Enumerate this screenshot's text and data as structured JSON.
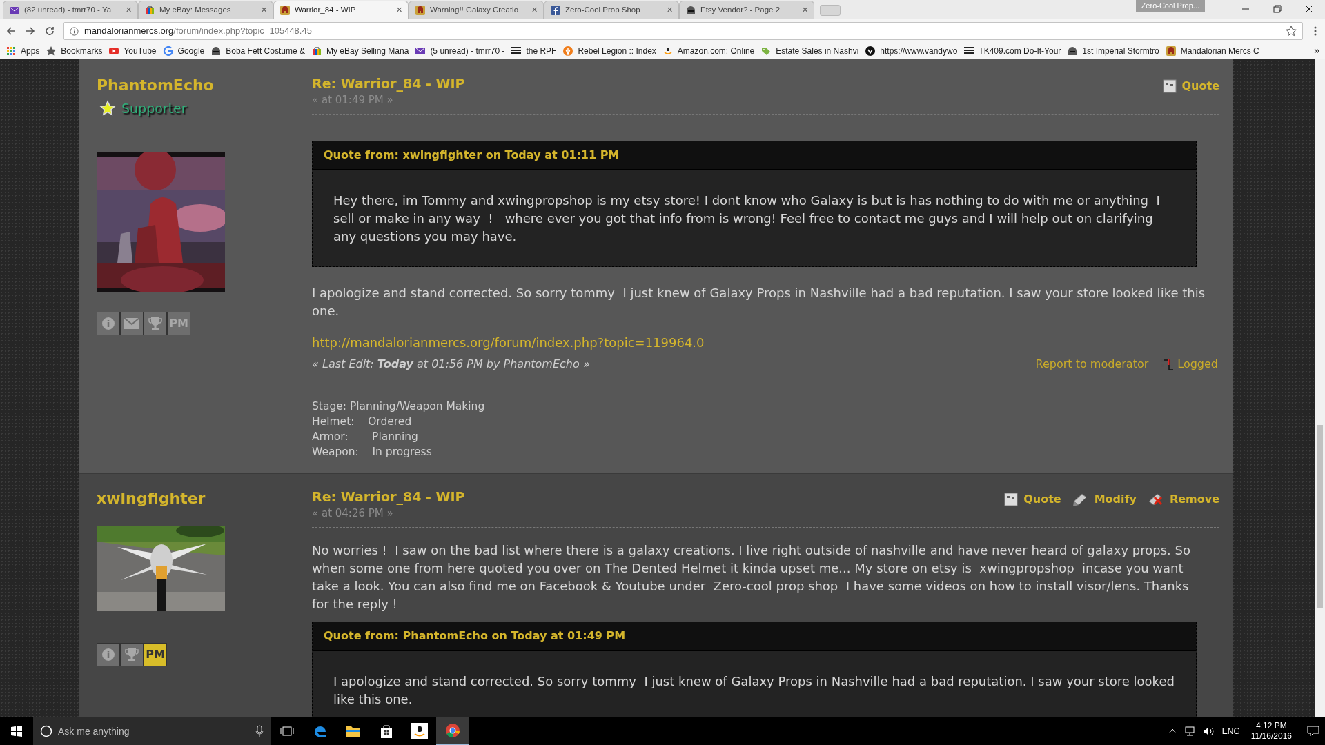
{
  "browser": {
    "tabs": [
      {
        "title": "(82 unread) - tmrr70 - Ya",
        "kind": "mail",
        "selected": false,
        "close": "✕"
      },
      {
        "title": "My eBay: Messages",
        "kind": "bag",
        "selected": false,
        "close": "✕"
      },
      {
        "title": "Warrior_84 - WIP",
        "kind": "helmet",
        "selected": true,
        "close": "✕"
      },
      {
        "title": "Warning!! Galaxy Creatio",
        "kind": "helmet",
        "selected": false,
        "close": "✕"
      },
      {
        "title": "Zero-Cool Prop Shop",
        "kind": "facebook",
        "selected": false,
        "close": "✕"
      },
      {
        "title": "Etsy Vendor? - Page 2",
        "kind": "dome",
        "selected": false,
        "close": "✕"
      }
    ],
    "profile": "Zero-Cool Prop...",
    "address": {
      "domain": "mandalorianmercs.org",
      "path": "/forum/index.php?topic=105448.45"
    },
    "bookmarks": [
      {
        "label": "Apps",
        "kind": "apps"
      },
      {
        "label": "Bookmarks",
        "kind": "star"
      },
      {
        "label": "YouTube",
        "kind": "youtube"
      },
      {
        "label": "Google",
        "kind": "google"
      },
      {
        "label": "Boba Fett Costume &",
        "kind": "dome"
      },
      {
        "label": "My eBay Selling Mana",
        "kind": "bag"
      },
      {
        "label": "(5 unread) - tmrr70 -",
        "kind": "mail"
      },
      {
        "label": "the RPF",
        "kind": "rpf"
      },
      {
        "label": "Rebel Legion :: Index",
        "kind": "rebel"
      },
      {
        "label": "Amazon.com: Online",
        "kind": "amazon"
      },
      {
        "label": "Estate Sales in Nashvi",
        "kind": "tag"
      },
      {
        "label": "https://www.vandywo",
        "kind": "circle"
      },
      {
        "label": "TK409.com Do-It-Your",
        "kind": "rpf"
      },
      {
        "label": "1st Imperial Stormtro",
        "kind": "dome"
      },
      {
        "label": "Mandalorian Mercs C",
        "kind": "helmet"
      }
    ],
    "overflow": "»"
  },
  "posts": [
    {
      "author": "PhantomEcho",
      "rank": "Supporter",
      "profile_buttons": [
        {
          "kind": "info",
          "highlighted": false
        },
        {
          "kind": "email",
          "highlighted": false
        },
        {
          "kind": "trophy",
          "highlighted": false
        },
        {
          "kind": "pm",
          "label": "PM",
          "highlighted": false
        }
      ],
      "title": "Re: Warrior_84 - WIP",
      "time": "« at 01:49 PM »",
      "actions": [
        {
          "kind": "quote",
          "label": "Quote"
        }
      ],
      "quote": {
        "header": "Quote from: xwingfighter on Today at 01:11 PM",
        "text": "Hey there, im Tommy and xwingpropshop is my etsy store! I dont know who Galaxy is but is has nothing to do with me or anything  I sell or make in any way  !   where ever you got that info from is wrong! Feel free to contact me guys and I will help out on clarifying any questions you may have."
      },
      "body": "I apologize and stand corrected. So sorry tommy  I just knew of Galaxy Props in Nashville had a bad reputation. I saw your store looked like this one.",
      "link": "http://mandalorianmercs.org/forum/index.php?topic=119964.0",
      "last_edit": "« Last Edit: **Today** at 01:56 PM by PhantomEcho »",
      "report": "Report to moderator",
      "logged": "Logged",
      "signature": [
        "Stage: Planning/Weapon Making",
        "Helmet:    Ordered",
        "Armor:       Planning",
        "Weapon:    In progress"
      ]
    },
    {
      "author": "xwingfighter",
      "profile_buttons": [
        {
          "kind": "info",
          "highlighted": false
        },
        {
          "kind": "trophy",
          "highlighted": false
        },
        {
          "kind": "pm",
          "label": "PM",
          "highlighted": true
        }
      ],
      "title": "Re: Warrior_84 - WIP",
      "time": "« at 04:26 PM »",
      "actions": [
        {
          "kind": "quote",
          "label": "Quote"
        },
        {
          "kind": "modify",
          "label": "Modify"
        },
        {
          "kind": "remove",
          "label": "Remove"
        }
      ],
      "body": "No worries !  I saw on the bad list where there is a galaxy creations. I live right outside of nashville and have never heard of galaxy props. So when some one from here quoted you over on The Dented Helmet it kinda upset me... My store on etsy is  xwingpropshop  incase you want take a look. You can also find me on Facebook & Youtube under  Zero-cool prop shop  I have some videos on how to install visor/lens. Thanks for the reply !",
      "quote": {
        "header": "Quote from: PhantomEcho on Today at 01:49 PM",
        "text": "I apologize and stand corrected. So sorry tommy  I just knew of Galaxy Props in Nashville had a bad reputation. I saw your store looked like this one."
      }
    }
  ],
  "taskbar": {
    "search": {
      "placeholder": "Ask me anything"
    },
    "apps": [
      {
        "kind": "taskview",
        "selected": false
      },
      {
        "kind": "edge",
        "selected": false
      },
      {
        "kind": "explorer",
        "selected": false
      },
      {
        "kind": "store",
        "selected": false
      },
      {
        "kind": "amazon",
        "selected": false
      },
      {
        "kind": "chrome",
        "selected": true
      }
    ],
    "language": "ENG",
    "time": "4:12 PM",
    "date": "11/16/2016"
  }
}
